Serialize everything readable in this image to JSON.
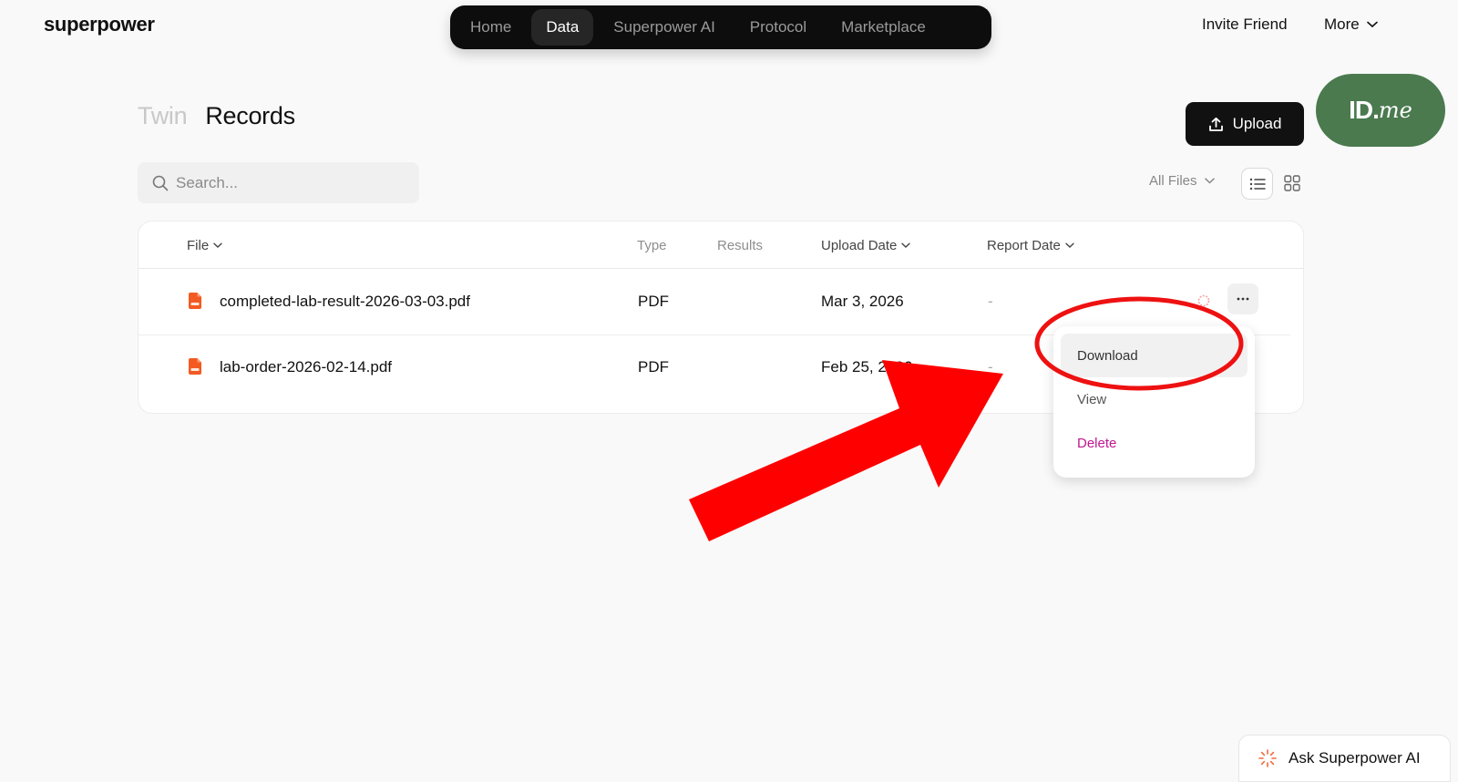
{
  "app": {
    "logo": "superpower"
  },
  "nav": {
    "items": [
      {
        "label": "Home",
        "active": false
      },
      {
        "label": "Data",
        "active": true
      },
      {
        "label": "Superpower AI",
        "active": false
      },
      {
        "label": "Protocol",
        "active": false
      },
      {
        "label": "Marketplace",
        "active": false
      }
    ]
  },
  "header": {
    "invite": "Invite Friend",
    "more": "More"
  },
  "tabs": [
    {
      "label": "Twin",
      "active": false
    },
    {
      "label": "Records",
      "active": true
    }
  ],
  "upload": {
    "label": "Upload"
  },
  "idme": {
    "id": "ID.",
    "me": "me"
  },
  "search": {
    "placeholder": "Search..."
  },
  "filter": {
    "label": "All Files"
  },
  "table": {
    "headers": {
      "file": "File",
      "type": "Type",
      "results": "Results",
      "upload_date": "Upload Date",
      "report_date": "Report Date"
    },
    "rows": [
      {
        "file": "completed-lab-result-2026-03-03.pdf",
        "type": "PDF",
        "results": "",
        "upload_date": "Mar 3, 2026",
        "report_date": "-"
      },
      {
        "file": "lab-order-2026-02-14.pdf",
        "type": "PDF",
        "results": "",
        "upload_date": "Feb 25, 2026",
        "report_date": "-"
      }
    ]
  },
  "menu": {
    "items": [
      {
        "label": "Download",
        "highlighted": true
      },
      {
        "label": "View",
        "highlighted": false
      },
      {
        "label": "Delete",
        "highlighted": false
      }
    ]
  },
  "assistant": {
    "label": "Ask Superpower AI"
  },
  "colors": {
    "annotation_red": "#ff0000",
    "delete_magenta": "#c0168f",
    "pdf_orange": "#f25a22",
    "idme_green": "#4a7a4e"
  }
}
